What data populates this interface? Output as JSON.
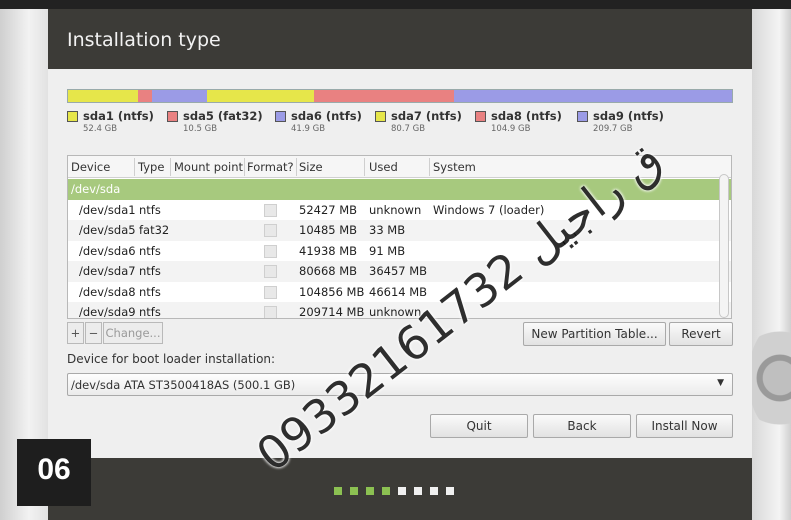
{
  "window": {
    "title": "Installation type"
  },
  "disk_bar": {
    "segments": [
      {
        "color": "#e6e64a",
        "fraction": 0.105
      },
      {
        "color": "#e98181",
        "fraction": 0.021
      },
      {
        "color": "#9b9be6",
        "fraction": 0.084
      },
      {
        "color": "#e6e64a",
        "fraction": 0.161
      },
      {
        "color": "#e98181",
        "fraction": 0.21
      },
      {
        "color": "#9b9be6",
        "fraction": 0.419
      }
    ]
  },
  "legend": [
    {
      "name": "sda1 (ntfs)",
      "size": "52.4 GB",
      "color": "#e6e64a"
    },
    {
      "name": "sda5 (fat32)",
      "size": "10.5 GB",
      "color": "#e98181"
    },
    {
      "name": "sda6 (ntfs)",
      "size": "41.9 GB",
      "color": "#9b9be6"
    },
    {
      "name": "sda7 (ntfs)",
      "size": "80.7 GB",
      "color": "#e6e64a"
    },
    {
      "name": "sda8 (ntfs)",
      "size": "104.9 GB",
      "color": "#e98181"
    },
    {
      "name": "sda9 (ntfs)",
      "size": "209.7 GB",
      "color": "#9b9be6"
    }
  ],
  "table": {
    "headers": [
      "Device",
      "Type",
      "Mount point",
      "Format?",
      "Size",
      "Used",
      "System"
    ],
    "rows": [
      {
        "device": "/dev/sda",
        "type": "",
        "mount": "",
        "size": "",
        "used": "",
        "system": ""
      },
      {
        "device": "/dev/sda1",
        "type": "ntfs",
        "mount": "",
        "size": "52427 MB",
        "used": "unknown",
        "system": "Windows 7 (loader)"
      },
      {
        "device": "/dev/sda5",
        "type": "fat32",
        "mount": "",
        "size": "10485 MB",
        "used": "33 MB",
        "system": ""
      },
      {
        "device": "/dev/sda6",
        "type": "ntfs",
        "mount": "",
        "size": "41938 MB",
        "used": "91 MB",
        "system": ""
      },
      {
        "device": "/dev/sda7",
        "type": "ntfs",
        "mount": "",
        "size": "80668 MB",
        "used": "36457 MB",
        "system": ""
      },
      {
        "device": "/dev/sda8",
        "type": "ntfs",
        "mount": "",
        "size": "104856 MB",
        "used": "46614 MB",
        "system": ""
      },
      {
        "device": "/dev/sda9",
        "type": "ntfs",
        "mount": "",
        "size": "209714 MB",
        "used": "unknown",
        "system": ""
      }
    ]
  },
  "toolbar": {
    "add_label": "+",
    "remove_label": "−",
    "change_label": "Change...",
    "new_table_label": "New Partition Table...",
    "revert_label": "Revert"
  },
  "boot_loader": {
    "label": "Device for boot loader installation:",
    "selected": "/dev/sda   ATA ST3500418AS (500.1 GB)"
  },
  "buttons": {
    "quit": "Quit",
    "back": "Back",
    "install": "Install Now"
  },
  "progress": {
    "total_steps": 8,
    "completed_steps": 4
  },
  "step_badge": "06",
  "watermark": "ق راجيل 09332161732",
  "colors": {
    "selected_row": "#a7c97e",
    "title_bar": "#3c3b37",
    "progress_done": "#8cc152"
  }
}
